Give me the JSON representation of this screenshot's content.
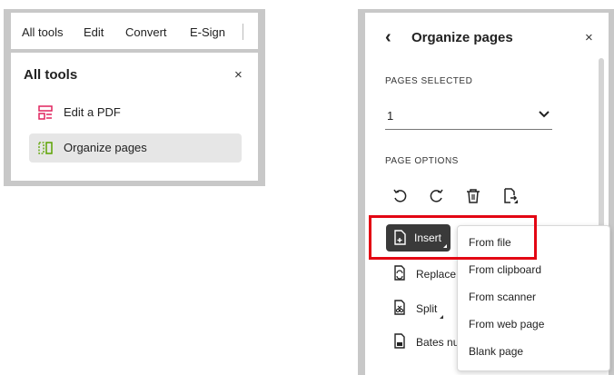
{
  "toolbar": {
    "tabs": [
      {
        "label": "All tools"
      },
      {
        "label": "Edit"
      },
      {
        "label": "Convert"
      },
      {
        "label": "E-Sign"
      }
    ]
  },
  "all_tools_panel": {
    "title": "All tools",
    "close": "×",
    "items": [
      {
        "label": "Edit a PDF",
        "icon": "edit-pdf-icon"
      },
      {
        "label": "Organize pages",
        "icon": "organize-pages-icon",
        "selected": true
      }
    ]
  },
  "organize_panel": {
    "title": "Organize pages",
    "back": "‹",
    "close": "×",
    "pages_selected_label": "PAGES SELECTED",
    "pages_selected_value": "1",
    "page_options_label": "PAGE OPTIONS",
    "option_icons": [
      "rotate-left-icon",
      "rotate-right-icon",
      "delete-icon",
      "extract-icon"
    ],
    "insert_label": "Insert",
    "replace_label": "Replace",
    "split_label": "Split",
    "bates_label": "Bates nu",
    "insert_menu": [
      "From file",
      "From clipboard",
      "From scanner",
      "From web page",
      "Blank page"
    ]
  },
  "colors": {
    "highlight": "#e30613",
    "edit_icon": "#e0245e",
    "organize_icon": "#5ba300",
    "insert_button": "#3a3a3a"
  }
}
